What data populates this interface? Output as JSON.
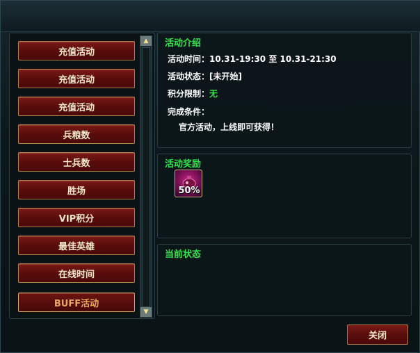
{
  "menu": {
    "items": [
      {
        "label": "充值活动"
      },
      {
        "label": "充值活动"
      },
      {
        "label": "充值活动"
      },
      {
        "label": "兵粮数"
      },
      {
        "label": "士兵数"
      },
      {
        "label": "胜场"
      },
      {
        "label": "VIP积分"
      },
      {
        "label": "最佳英雄"
      },
      {
        "label": "在线时间"
      },
      {
        "label": "BUFF活动"
      }
    ],
    "selected_index": 9
  },
  "scrollbar": {
    "up_icon": "arrow-up",
    "down_icon": "arrow-down"
  },
  "intro": {
    "title": "活动介绍",
    "time_label": "活动时间：",
    "time_value": "10.31-19:30 至 10.31-21:30",
    "status_label": "活动状态：",
    "status_value": "[未开始]",
    "points_label": "积分限制：",
    "points_value": "无",
    "condition_label": "完成条件：",
    "condition_value": "官方活动，上线即可获得！"
  },
  "reward": {
    "title": "活动奖励",
    "icon": "buff-potion-icon",
    "percent": "50%"
  },
  "current": {
    "title": "当前状态"
  },
  "close_label": "关闭",
  "colors": {
    "accent_green": "#33e24a",
    "button_red": "#5a0d0c",
    "button_border": "#b3804c"
  }
}
